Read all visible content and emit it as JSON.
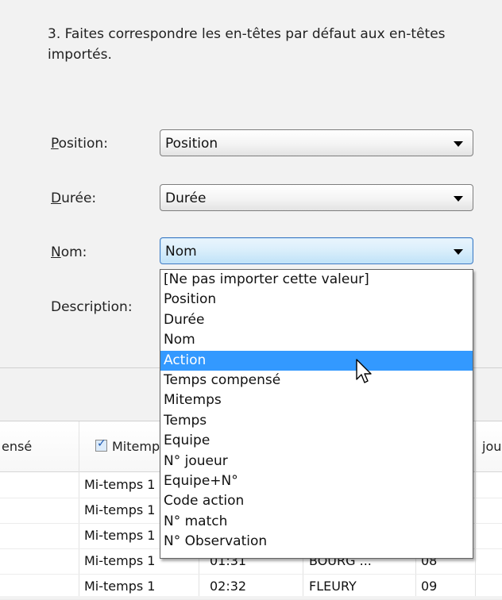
{
  "instruction": {
    "line1": "3. Faites correspondre les en-têtes par défaut aux en-têtes",
    "line2": "importés."
  },
  "mappings": [
    {
      "label_accel": "P",
      "label_rest": "osition:",
      "value": "Position"
    },
    {
      "label_accel": "D",
      "label_rest": "urée:",
      "value": "Durée"
    },
    {
      "label_accel": "N",
      "label_rest": "om:",
      "value": "Nom"
    },
    {
      "label_full": "Description:"
    }
  ],
  "dropdown": {
    "options": [
      "[Ne pas importer cette valeur]",
      "Position",
      "Durée",
      "Nom",
      "Action",
      "Temps compensé",
      "Mitemps",
      "Temps",
      "Equipe",
      "N° joueur",
      "Equipe+N°",
      "Code action",
      "N° match",
      "N° Observation"
    ],
    "highlighted": "Action"
  },
  "grid": {
    "headers": {
      "left_fragment": "ensé",
      "mitemps": "Mitemps",
      "right_fragment": "jou"
    },
    "mitemps_checked": true,
    "rows": [
      {
        "mitemps": "Mi-temps 1",
        "duree": "",
        "equipe": "",
        "num": ""
      },
      {
        "mitemps": "Mi-temps 1",
        "duree": "",
        "equipe": "",
        "num": ""
      },
      {
        "mitemps": "Mi-temps 1",
        "duree": "",
        "equipe": "",
        "num": ""
      },
      {
        "mitemps": "Mi-temps 1",
        "duree": "01:31",
        "equipe": "BOURG ...",
        "num": "08"
      },
      {
        "mitemps": "Mi-temps 1",
        "duree": "02:32",
        "equipe": "FLEURY",
        "num": "09"
      }
    ]
  },
  "colors": {
    "selection": "#3399ff",
    "active_border": "#3d7bc4",
    "background": "#f2f2f2"
  },
  "icons": {
    "combo_arrow": "chevron-down-icon",
    "cursor": "mouse-pointer-icon",
    "checkbox": "checkbox-checked-icon"
  }
}
